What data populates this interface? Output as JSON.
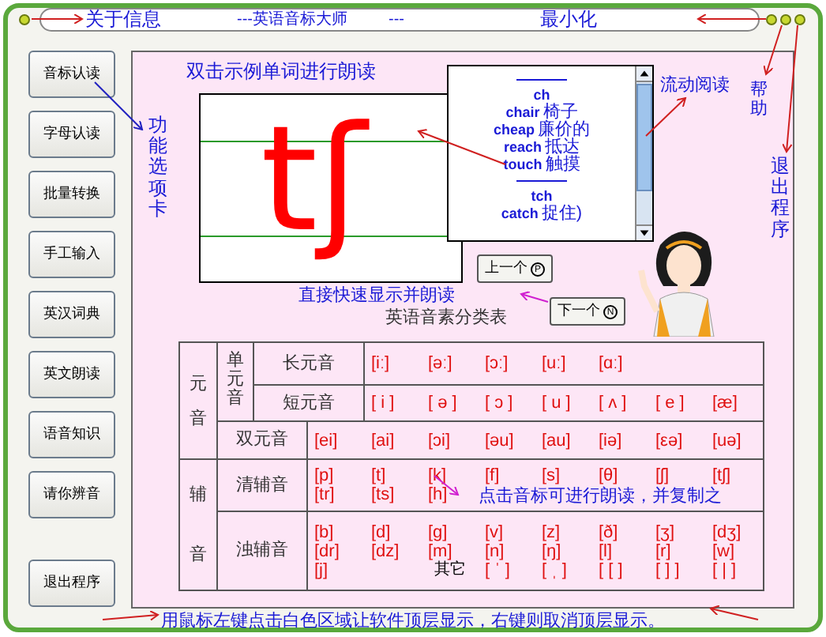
{
  "title_bar": {
    "about": "关于信息",
    "title": "---英语音标大师",
    "dashes": "---",
    "minimize": "最小化"
  },
  "sidebar": {
    "items": [
      {
        "label": "音标认读"
      },
      {
        "label": "字母认读"
      },
      {
        "label": "批量转换"
      },
      {
        "label": "手工输入"
      },
      {
        "label": "英汉词典"
      },
      {
        "label": "英文朗读"
      },
      {
        "label": "语音知识"
      },
      {
        "label": "请你辨音"
      }
    ],
    "exit": "退出程序"
  },
  "annotations": {
    "tabs": "功能选项卡",
    "double_click": "双击示例单词进行朗读",
    "scroll_read": "流动阅读",
    "help": "帮助",
    "exit": "退出程序",
    "quick_show": "直接快速显示并朗读",
    "click_symbol": "点击音标可进行朗读，并复制之",
    "footer": "用鼠标左键点击白色区域让软件顶层显示，右键则取消顶层显示。"
  },
  "symbol_display": {
    "symbol": "tʃ"
  },
  "examples": [
    {
      "kind": "rule"
    },
    {
      "kind": "heading",
      "text": "ch"
    },
    {
      "kind": "word",
      "word": "chair",
      "meaning": "椅子"
    },
    {
      "kind": "word",
      "word": "cheap",
      "meaning": "廉价的"
    },
    {
      "kind": "word",
      "word": "reach",
      "meaning": "抵达"
    },
    {
      "kind": "word",
      "word": "touch",
      "meaning": "触摸"
    },
    {
      "kind": "rule"
    },
    {
      "kind": "heading",
      "text": "tch"
    },
    {
      "kind": "word",
      "word": "catch",
      "meaning": "捉住)"
    }
  ],
  "nav": {
    "previous": "上一个",
    "previous_key": "P",
    "next": "下一个",
    "next_key": "N"
  },
  "table": {
    "title": "英语音素分类表",
    "vowel_group": "元音",
    "monophthong": "单元音",
    "consonant_group": "辅音",
    "long_vowels": {
      "label": "长元音",
      "symbols": [
        "[iː]",
        "[əː]",
        "[ɔː]",
        "[uː]",
        "[ɑː]"
      ]
    },
    "short_vowels": {
      "label": "短元音",
      "symbols": [
        "[ i ]",
        "[ ə ]",
        "[ ɔ ]",
        "[ u ]",
        "[ ʌ ]",
        "[ e ]",
        "[æ]"
      ]
    },
    "diphthongs": {
      "label": "双元音",
      "symbols": [
        "[ei]",
        "[ai]",
        "[ɔi]",
        "[əu]",
        "[au]",
        "[iə]",
        "[εə]",
        "[uə]"
      ]
    },
    "voiceless": {
      "label": "清辅音",
      "columns": [
        {
          "symbols": [
            "[p]",
            "[tr]"
          ]
        },
        {
          "symbols": [
            "[t]",
            "[ts]"
          ]
        },
        {
          "symbols": [
            "[k]",
            "[h]"
          ]
        },
        {
          "symbols": [
            "[f]"
          ]
        },
        {
          "symbols": [
            "[s]"
          ]
        },
        {
          "symbols": [
            "[θ]"
          ]
        },
        {
          "symbols": [
            "[ʃ]"
          ]
        },
        {
          "symbols": [
            "[tʃ]"
          ]
        }
      ]
    },
    "voiced": {
      "label": "浊辅音",
      "columns": [
        {
          "symbols": [
            "[b]",
            "[dr]",
            "[j]"
          ]
        },
        {
          "symbols": [
            "[d]",
            "[dz]"
          ]
        },
        {
          "symbols": [
            "[g]",
            "[m]"
          ],
          "note": "其它"
        },
        {
          "symbols": [
            "[v]",
            "[n]",
            "[ ˈ ]"
          ]
        },
        {
          "symbols": [
            "[z]",
            "[ŋ]",
            "[ ˌ ]"
          ]
        },
        {
          "symbols": [
            "[ð]",
            "[l]",
            "[ [ ]"
          ]
        },
        {
          "symbols": [
            "[ʒ]",
            "[r]",
            "[ ] ]"
          ]
        },
        {
          "symbols": [
            "[dʒ]",
            "[w]",
            "[ | ]"
          ]
        }
      ]
    }
  }
}
